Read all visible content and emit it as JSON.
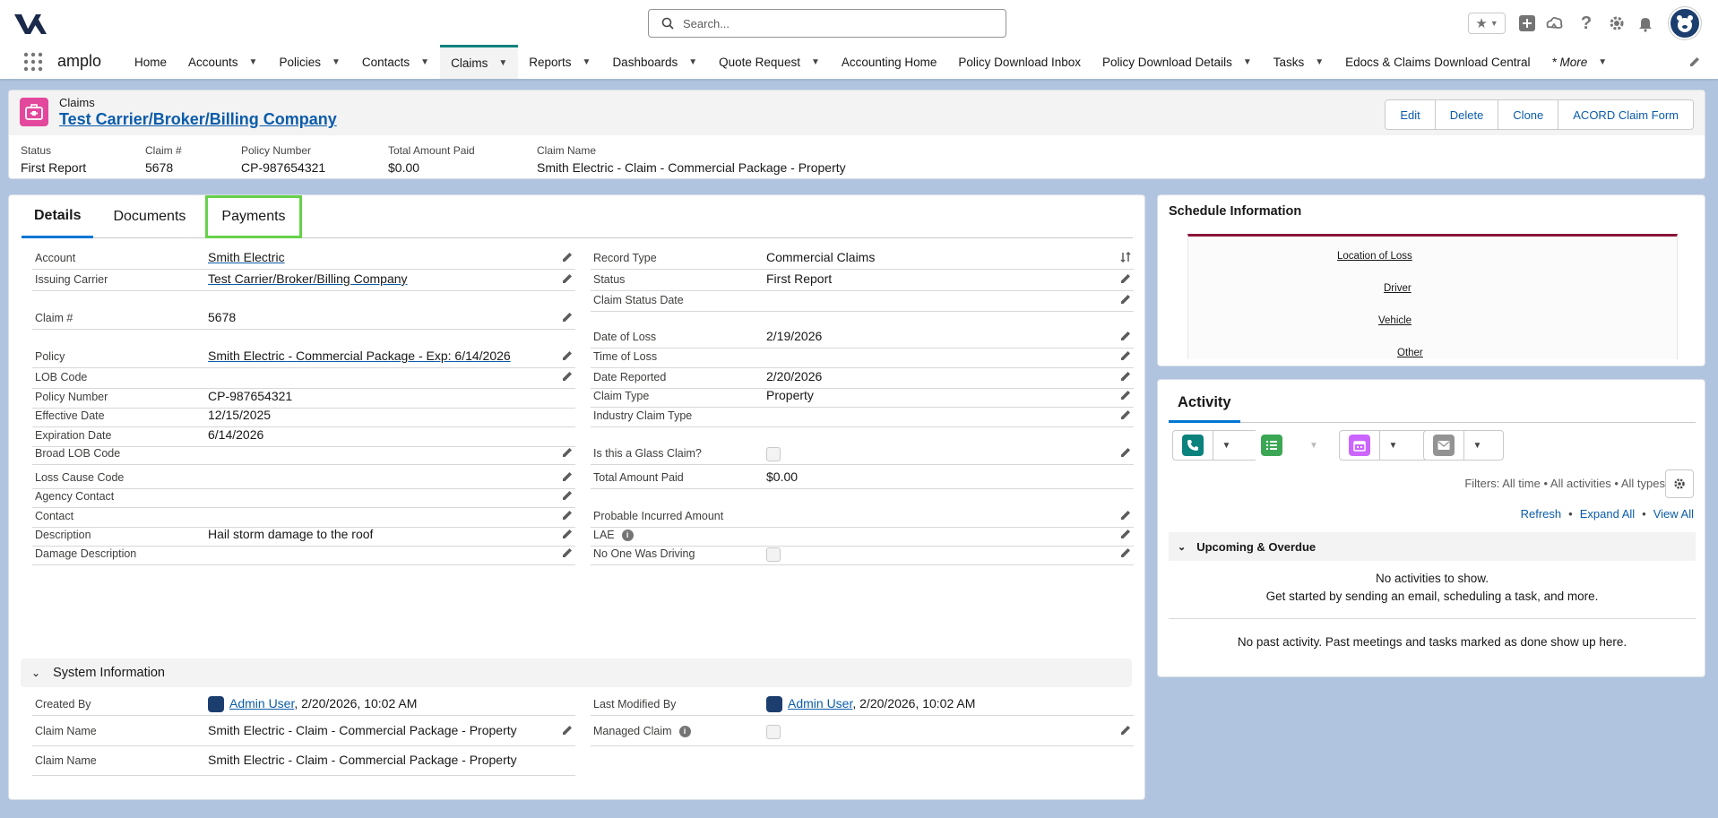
{
  "global": {
    "search_placeholder": "Search...",
    "app_name": "amplo"
  },
  "nav": {
    "items": [
      {
        "label": "Home",
        "chevron": false
      },
      {
        "label": "Accounts",
        "chevron": true
      },
      {
        "label": "Policies",
        "chevron": true
      },
      {
        "label": "Contacts",
        "chevron": true
      },
      {
        "label": "Claims",
        "chevron": true,
        "active": true
      },
      {
        "label": "Reports",
        "chevron": true
      },
      {
        "label": "Dashboards",
        "chevron": true
      },
      {
        "label": "Quote Request",
        "chevron": true
      },
      {
        "label": "Accounting Home",
        "chevron": false
      },
      {
        "label": "Policy Download Inbox",
        "chevron": false
      },
      {
        "label": "Policy Download Details",
        "chevron": true
      },
      {
        "label": "Tasks",
        "chevron": true
      },
      {
        "label": "Edocs & Claims Download Central",
        "chevron": false
      },
      {
        "label": "* More",
        "chevron": true
      }
    ]
  },
  "record": {
    "object": "Claims",
    "title": "Test Carrier/Broker/Billing Company",
    "buttons": [
      "Edit",
      "Delete",
      "Clone",
      "ACORD Claim Form"
    ],
    "highlights": [
      {
        "label": "Status",
        "value": "First Report"
      },
      {
        "label": "Claim #",
        "value": "5678"
      },
      {
        "label": "Policy Number",
        "value": "CP-987654321"
      },
      {
        "label": "Total Amount Paid",
        "value": "$0.00"
      },
      {
        "label": "Claim Name",
        "value": "Smith Electric - Claim - Commercial Package - Property"
      }
    ]
  },
  "tabs": [
    "Details",
    "Documents",
    "Payments"
  ],
  "left_fields": [
    {
      "label": "Account",
      "value": "Smith Electric",
      "link": true
    },
    {
      "label": "Issuing Carrier",
      "value": "Test Carrier/Broker/Billing Company",
      "link": true
    },
    {
      "label": "Claim #",
      "value": "5678"
    },
    {
      "label": "Policy",
      "value": "Smith Electric - Commercial Package - Exp: 6/14/2026",
      "link": true
    },
    {
      "label": "LOB Code",
      "value": ""
    },
    {
      "label": "Policy Number",
      "value": "CP-987654321",
      "noedit": true
    },
    {
      "label": "Effective Date",
      "value": "12/15/2025",
      "noedit": true
    },
    {
      "label": "Expiration Date",
      "value": "6/14/2026",
      "noedit": true
    },
    {
      "label": "Broad LOB Code",
      "value": ""
    },
    {
      "label": "Loss Cause Code",
      "value": ""
    },
    {
      "label": "Agency Contact",
      "value": ""
    },
    {
      "label": "Contact",
      "value": ""
    },
    {
      "label": "Description",
      "value": "Hail storm damage to the roof"
    },
    {
      "label": "Damage Description",
      "value": ""
    }
  ],
  "right_fields": [
    {
      "label": "Record Type",
      "value": "Commercial Claims"
    },
    {
      "label": "Status",
      "value": "First Report"
    },
    {
      "label": "Claim Status Date",
      "value": ""
    },
    {
      "label": "Date of Loss",
      "value": "2/19/2026"
    },
    {
      "label": "Time of Loss",
      "value": ""
    },
    {
      "label": "Date Reported",
      "value": "2/20/2026"
    },
    {
      "label": "Claim Type",
      "value": "Property"
    },
    {
      "label": "Industry Claim Type",
      "value": ""
    },
    {
      "label": "Is this a Glass Claim?",
      "value": ""
    },
    {
      "label": "Total Amount Paid",
      "value": "$0.00",
      "noedit": true
    },
    {
      "label": "Probable Incurred Amount",
      "value": ""
    },
    {
      "label": "LAE",
      "value": ""
    },
    {
      "label": "No One Was Driving",
      "value": ""
    }
  ],
  "system": {
    "title": "System Information",
    "created_by_label": "Created By",
    "created_by_user": "Admin User",
    "created_by_date": ", 2/20/2026, 10:02 AM",
    "modified_by_label": "Last Modified By",
    "modified_by_user": "Admin User",
    "modified_by_date": ", 2/20/2026, 10:02 AM",
    "claim_name_label": "Claim Name",
    "claim_name_value": "Smith Electric - Claim - Commercial Package - Property",
    "managed_claim_label": "Managed Claim",
    "claim_name2_label": "Claim Name",
    "claim_name2_value": "Smith Electric - Claim - Commercial Package - Property"
  },
  "schedule": {
    "title": "Schedule Information",
    "links": [
      "Location of Loss",
      "Driver",
      "Vehicle",
      "Other"
    ]
  },
  "activity": {
    "tab": "Activity",
    "filters": "Filters: All time • All activities • All types",
    "refresh": "Refresh",
    "expand_all": "Expand All",
    "view_all": "View All",
    "upcoming": "Upcoming & Overdue",
    "no_activities": "No activities to show.",
    "get_started": "Get started by sending an email, scheduling a task, and more.",
    "past": "No past activity. Past meetings and tasks marked as done show up here."
  }
}
